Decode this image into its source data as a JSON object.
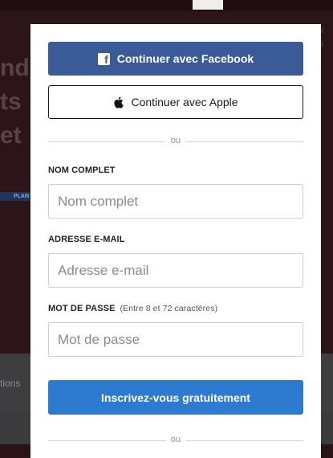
{
  "background": {
    "headline_lines": [
      "nd",
      "ts",
      "et"
    ],
    "badge": "PLAN",
    "mid_text": "tions",
    "right_text": [
      "v",
      "s"
    ]
  },
  "modal": {
    "facebook_label": "Continuer avec Facebook",
    "facebook_icon_glyph": "f",
    "apple_label": "Continuer avec Apple",
    "divider_text": "ou",
    "name_label": "NOM COMPLET",
    "name_placeholder": "Nom complet",
    "email_label": "ADRESSE E-MAIL",
    "email_placeholder": "Adresse e-mail",
    "password_label": "MOT DE PASSE",
    "password_hint": "(Entre 8 et 72 caractères)",
    "password_placeholder": "Mot de passe",
    "signup_label": "Inscrivez-vous gratuitement",
    "divider_bottom_text": "ou"
  },
  "colors": {
    "facebook": "#3b5a98",
    "signup": "#2d7ad1",
    "backdrop": "#2b1519"
  }
}
